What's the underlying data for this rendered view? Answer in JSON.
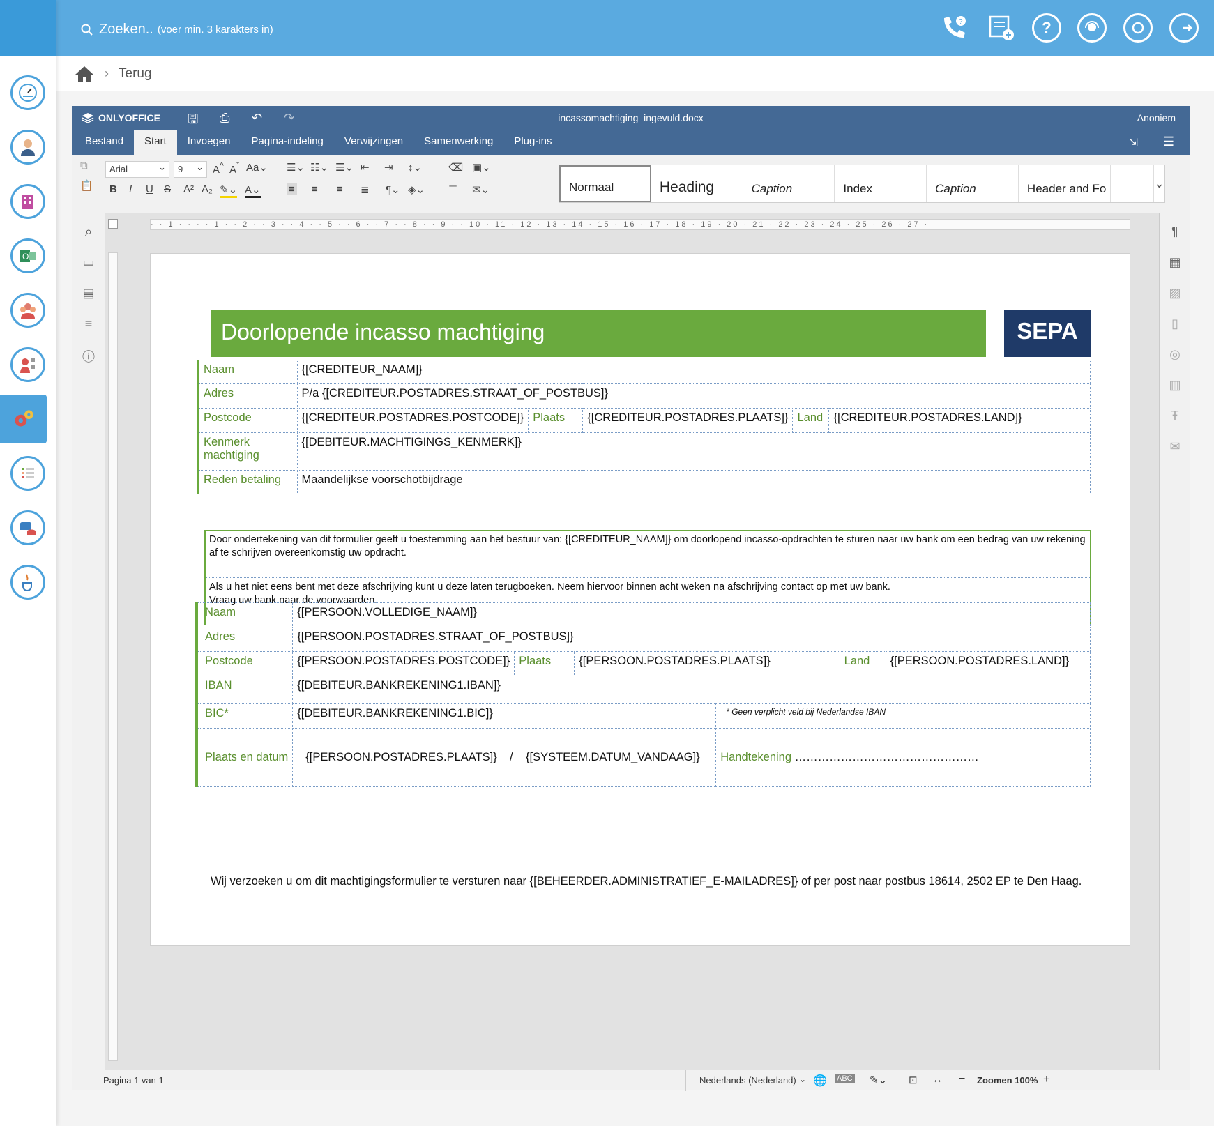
{
  "search": {
    "label": "Zoeken..",
    "hint": "(voer min. 3 karakters in)"
  },
  "breadcrumb": {
    "back": "Terug"
  },
  "editor": {
    "brand": "ONLYOFFICE",
    "filename": "incassomachtiging_ingevuld.docx",
    "user": "Anoniem",
    "tabs": [
      "Bestand",
      "Start",
      "Invoegen",
      "Pagina-indeling",
      "Verwijzingen",
      "Samenwerking",
      "Plug-ins"
    ],
    "font_name": "Arial",
    "font_size": "9",
    "styles": [
      "Normaal",
      "Heading",
      "Caption",
      "Index",
      "Caption",
      "Header and Fo"
    ]
  },
  "document": {
    "title": "Doorlopende incasso machtiging",
    "badge": "SEPA",
    "creditor": {
      "naam_label": "Naam",
      "naam": "{[CREDITEUR_NAAM]}",
      "adres_label": "Adres",
      "adres": "P/a {[CREDITEUR.POSTADRES.STRAAT_OF_POSTBUS]}",
      "postcode_label": "Postcode",
      "postcode": "{[CREDITEUR.POSTADRES.POSTCODE]}",
      "plaats_label": "Plaats",
      "plaats": "{[CREDITEUR.POSTADRES.PLAATS]}",
      "land_label": "Land",
      "land": "{[CREDITEUR.POSTADRES.LAND]}",
      "kenmerk_label": "Kenmerk machtiging",
      "kenmerk": "{[DEBITEUR.MACHTIGINGS_KENMERK]}",
      "reden_label": "Reden betaling",
      "reden": "Maandelijkse voorschotbijdrage"
    },
    "notice": {
      "p1": "Door ondertekening van dit formulier geeft u toestemming aan het bestuur van: {[CREDITEUR_NAAM]} om doorlopend incasso-opdrachten te sturen naar uw bank om een bedrag van uw rekening af te schrijven overeenkomstig uw opdracht.",
      "p2a": "Als u het niet eens bent met deze afschrijving kunt u deze laten terugboeken. Neem hiervoor binnen acht weken na afschrijving contact op met uw bank.",
      "p2b": "Vraag uw bank naar de voorwaarden."
    },
    "debtor": {
      "naam_label": "Naam",
      "naam": "{[PERSOON.VOLLEDIGE_NAAM]}",
      "adres_label": "Adres",
      "adres": "{[PERSOON.POSTADRES.STRAAT_OF_POSTBUS]}",
      "postcode_label": "Postcode",
      "postcode": "{[PERSOON.POSTADRES.POSTCODE]}",
      "plaats_label": "Plaats",
      "plaats": "{[PERSOON.POSTADRES.PLAATS]}",
      "land_label": "Land",
      "land": "{[PERSOON.POSTADRES.LAND]}",
      "iban_label": "IBAN",
      "iban": "{[DEBITEUR.BANKREKENING1.IBAN]}",
      "bic_label": "BIC*",
      "bic": "{[DEBITEUR.BANKREKENING1.BIC]}",
      "bic_note": "* Geen verplicht veld bij Nederlandse IBAN",
      "datum_label": "Plaats en datum",
      "datum": "{[PERSOON.POSTADRES.PLAATS]}    /    {[SYSTEEM.DATUM_VANDAAG]}",
      "handtekening_label": "Handtekening",
      "handtekening": "…………………………………………"
    },
    "footer": "Wij verzoeken u om dit machtigingsformulier te versturen naar {[BEHEERDER.ADMINISTRATIEF_E-MAILADRES]} of per post naar postbus 18614, 2502 EP te Den Haag."
  },
  "status": {
    "page": "Pagina 1 van 1",
    "language": "Nederlands (Nederland)",
    "zoom": "Zoomen 100%"
  },
  "colors": {
    "topbar": "#5aaae0",
    "oo_header": "#446995",
    "green": "#6aaa3e",
    "sepa": "#1f3a68"
  }
}
